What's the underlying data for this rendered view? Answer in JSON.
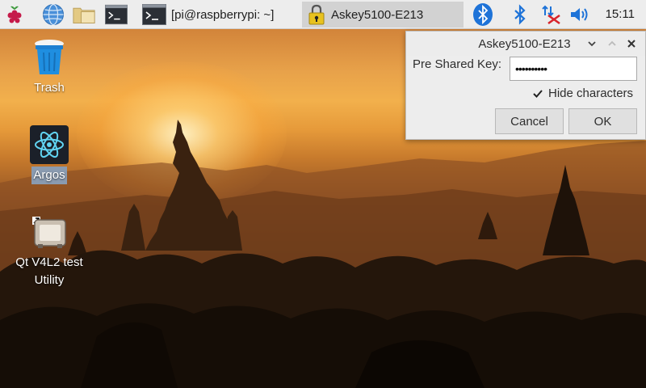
{
  "taskbar": {
    "launchers": [
      {
        "icon": "raspberry-menu-icon"
      },
      {
        "icon": "web-browser-icon"
      },
      {
        "icon": "file-manager-icon"
      },
      {
        "icon": "terminal-icon"
      }
    ],
    "windows": [
      {
        "icon": "terminal-icon",
        "label": "[pi@raspberrypi: ~]",
        "active": false
      },
      {
        "icon": "lock-icon",
        "label": "Askey5100-E213",
        "active": true
      }
    ],
    "tray": [
      {
        "icon": "bluetooth-app-icon"
      },
      {
        "icon": "bluetooth-icon"
      },
      {
        "icon": "network-disconnected-icon"
      },
      {
        "icon": "volume-icon"
      }
    ],
    "clock": "15:11"
  },
  "desktop": {
    "icons": [
      {
        "name": "trash",
        "label": "Trash",
        "selected": false
      },
      {
        "name": "argos",
        "label": "Argos",
        "selected": true
      },
      {
        "name": "qt-v4l2",
        "label": "Qt V4L2 test Utility",
        "selected": false
      }
    ]
  },
  "dialog": {
    "title": "Askey5100-E213",
    "key_label": "Pre Shared Key:",
    "key_value": "••••••••••",
    "hide_label": "Hide characters",
    "hide_checked": true,
    "cancel_label": "Cancel",
    "ok_label": "OK"
  },
  "colors": {
    "taskbar_bg": "#ededed",
    "active_window_bg": "#d2d2d2",
    "bluetooth_blue": "#1e73d8",
    "network_error_red": "#d8242c"
  }
}
